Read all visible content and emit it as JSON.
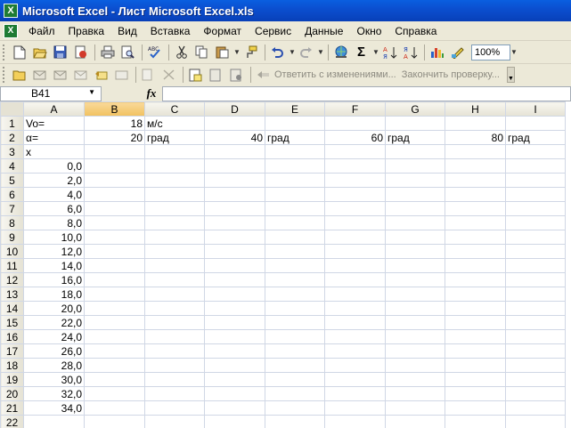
{
  "window": {
    "title": "Microsoft Excel - Лист Microsoft Excel.xls",
    "icon": "excel-icon"
  },
  "menu": [
    "Файл",
    "Правка",
    "Вид",
    "Вставка",
    "Формат",
    "Сервис",
    "Данные",
    "Окно",
    "Справка"
  ],
  "toolbar": {
    "standard_icons": [
      "new-icon",
      "open-icon",
      "save-icon",
      "permission-icon",
      "print-icon",
      "print-preview-icon",
      "spelling-icon",
      "cut-icon",
      "copy-icon",
      "paste-icon",
      "format-painter-icon",
      "undo-icon",
      "redo-icon",
      "hyperlink-icon",
      "autosum-icon",
      "sort-ascending-icon",
      "sort-descending-icon",
      "chart-wizard-icon",
      "drawing-icon"
    ],
    "zoom": "100%",
    "reviewing_reply": "Ответить с изменениями...",
    "reviewing_end": "Закончить проверку..."
  },
  "formula_bar": {
    "name_box": "B41",
    "fx": "fx",
    "formula": ""
  },
  "grid": {
    "columns": [
      "A",
      "B",
      "C",
      "D",
      "E",
      "F",
      "G",
      "H",
      "I"
    ],
    "selected_column": "B",
    "rows": [
      {
        "n": "1",
        "cells": [
          "Vo=",
          "18",
          "м/с",
          "",
          "",
          "",
          "",
          "",
          ""
        ]
      },
      {
        "n": "2",
        "cells": [
          "α=",
          "20",
          "град",
          "40",
          "град",
          "60",
          "град",
          "80",
          "град"
        ]
      },
      {
        "n": "3",
        "cells": [
          "x",
          "",
          "",
          "",
          "",
          "",
          "",
          "",
          ""
        ]
      },
      {
        "n": "4",
        "cells": [
          "0,0",
          "",
          "",
          "",
          "",
          "",
          "",
          "",
          ""
        ]
      },
      {
        "n": "5",
        "cells": [
          "2,0",
          "",
          "",
          "",
          "",
          "",
          "",
          "",
          ""
        ]
      },
      {
        "n": "6",
        "cells": [
          "4,0",
          "",
          "",
          "",
          "",
          "",
          "",
          "",
          ""
        ]
      },
      {
        "n": "7",
        "cells": [
          "6,0",
          "",
          "",
          "",
          "",
          "",
          "",
          "",
          ""
        ]
      },
      {
        "n": "8",
        "cells": [
          "8,0",
          "",
          "",
          "",
          "",
          "",
          "",
          "",
          ""
        ]
      },
      {
        "n": "9",
        "cells": [
          "10,0",
          "",
          "",
          "",
          "",
          "",
          "",
          "",
          ""
        ]
      },
      {
        "n": "10",
        "cells": [
          "12,0",
          "",
          "",
          "",
          "",
          "",
          "",
          "",
          ""
        ]
      },
      {
        "n": "11",
        "cells": [
          "14,0",
          "",
          "",
          "",
          "",
          "",
          "",
          "",
          ""
        ]
      },
      {
        "n": "12",
        "cells": [
          "16,0",
          "",
          "",
          "",
          "",
          "",
          "",
          "",
          ""
        ]
      },
      {
        "n": "13",
        "cells": [
          "18,0",
          "",
          "",
          "",
          "",
          "",
          "",
          "",
          ""
        ]
      },
      {
        "n": "14",
        "cells": [
          "20,0",
          "",
          "",
          "",
          "",
          "",
          "",
          "",
          ""
        ]
      },
      {
        "n": "15",
        "cells": [
          "22,0",
          "",
          "",
          "",
          "",
          "",
          "",
          "",
          ""
        ]
      },
      {
        "n": "16",
        "cells": [
          "24,0",
          "",
          "",
          "",
          "",
          "",
          "",
          "",
          ""
        ]
      },
      {
        "n": "17",
        "cells": [
          "26,0",
          "",
          "",
          "",
          "",
          "",
          "",
          "",
          ""
        ]
      },
      {
        "n": "18",
        "cells": [
          "28,0",
          "",
          "",
          "",
          "",
          "",
          "",
          "",
          ""
        ]
      },
      {
        "n": "19",
        "cells": [
          "30,0",
          "",
          "",
          "",
          "",
          "",
          "",
          "",
          ""
        ]
      },
      {
        "n": "20",
        "cells": [
          "32,0",
          "",
          "",
          "",
          "",
          "",
          "",
          "",
          ""
        ]
      },
      {
        "n": "21",
        "cells": [
          "34,0",
          "",
          "",
          "",
          "",
          "",
          "",
          "",
          ""
        ]
      },
      {
        "n": "22",
        "cells": [
          "",
          "",
          "",
          "",
          "",
          "",
          "",
          "",
          ""
        ]
      }
    ]
  }
}
